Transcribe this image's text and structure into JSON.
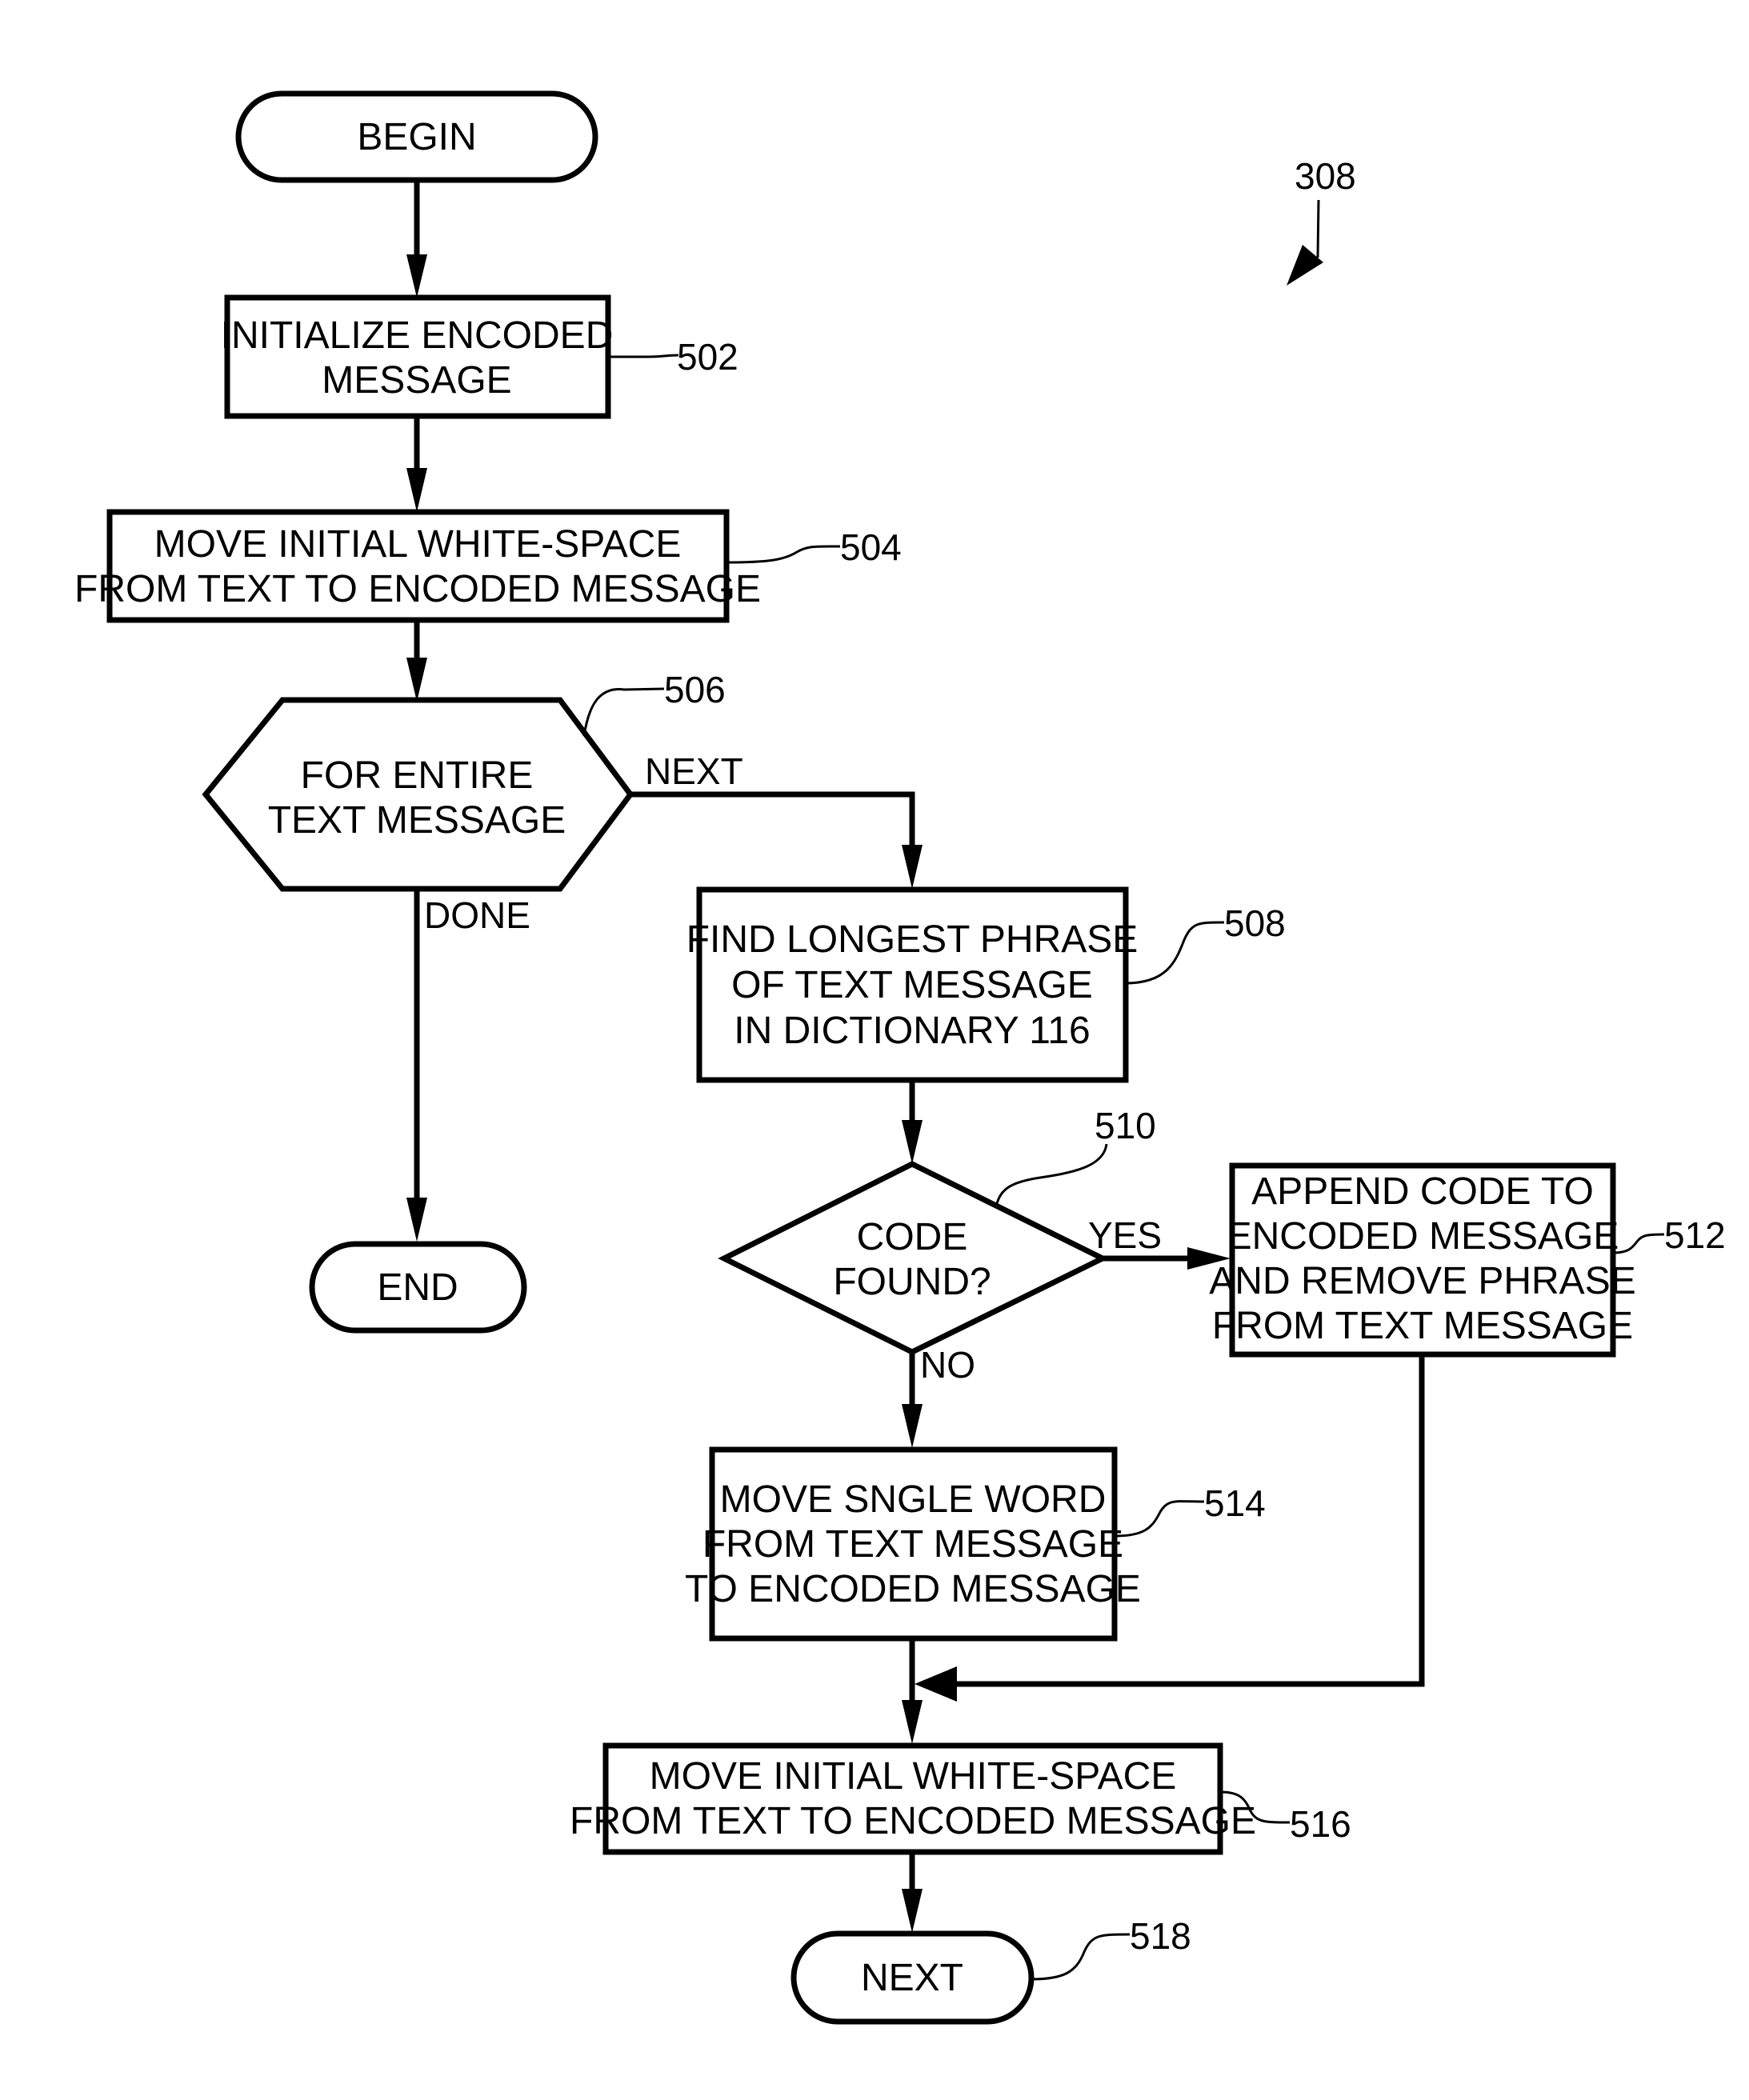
{
  "figure": {
    "ref_label": "308",
    "colors": {
      "stroke": "#000000",
      "background": "#ffffff"
    }
  },
  "nodes": {
    "begin": {
      "type": "terminal",
      "lines": [
        "BEGIN"
      ]
    },
    "n502": {
      "type": "process",
      "ref": "502",
      "lines": [
        "INITIALIZE ENCODED",
        "MESSAGE"
      ]
    },
    "n504": {
      "type": "process",
      "ref": "504",
      "lines": [
        "MOVE INITIAL WHITE-SPACE",
        "FROM TEXT TO ENCODED MESSAGE"
      ]
    },
    "n506": {
      "type": "loop",
      "ref": "506",
      "lines": [
        "FOR ENTIRE",
        "TEXT MESSAGE"
      ]
    },
    "n508": {
      "type": "process",
      "ref": "508",
      "lines": [
        "FIND LONGEST PHRASE",
        "OF TEXT MESSAGE",
        "IN DICTIONARY 116"
      ]
    },
    "n510": {
      "type": "decision",
      "ref": "510",
      "lines": [
        "CODE",
        "FOUND?"
      ]
    },
    "n512": {
      "type": "process",
      "ref": "512",
      "lines": [
        "APPEND CODE TO",
        "ENCODED MESSAGE",
        "AND REMOVE PHRASE",
        "FROM TEXT MESSAGE"
      ]
    },
    "n514": {
      "type": "process",
      "ref": "514",
      "lines": [
        "MOVE SNGLE WORD",
        "FROM TEXT MESSAGE",
        "TO ENCODED MESSAGE"
      ]
    },
    "n516": {
      "type": "process",
      "ref": "516",
      "lines": [
        "MOVE INITIAL WHITE-SPACE",
        "FROM TEXT TO ENCODED MESSAGE"
      ]
    },
    "n518": {
      "type": "terminal",
      "ref": "518",
      "lines": [
        "NEXT"
      ]
    },
    "end": {
      "type": "terminal",
      "lines": [
        "END"
      ]
    }
  },
  "edges": {
    "e_begin_502": {
      "from": "begin",
      "to": "n502",
      "label": ""
    },
    "e_502_504": {
      "from": "n502",
      "to": "n504",
      "label": ""
    },
    "e_504_506": {
      "from": "n504",
      "to": "n506",
      "label": ""
    },
    "e_506_508": {
      "from": "n506",
      "to": "n508",
      "label": "NEXT"
    },
    "e_506_end": {
      "from": "n506",
      "to": "end",
      "label": "DONE"
    },
    "e_508_510": {
      "from": "n508",
      "to": "n510",
      "label": ""
    },
    "e_510_512": {
      "from": "n510",
      "to": "n512",
      "label": "YES"
    },
    "e_510_514": {
      "from": "n510",
      "to": "n514",
      "label": "NO"
    },
    "e_514_516": {
      "from": "n514",
      "to": "n516",
      "label": ""
    },
    "e_512_516": {
      "from": "n512",
      "to": "n516",
      "label": ""
    },
    "e_516_518": {
      "from": "n516",
      "to": "n518",
      "label": ""
    }
  }
}
